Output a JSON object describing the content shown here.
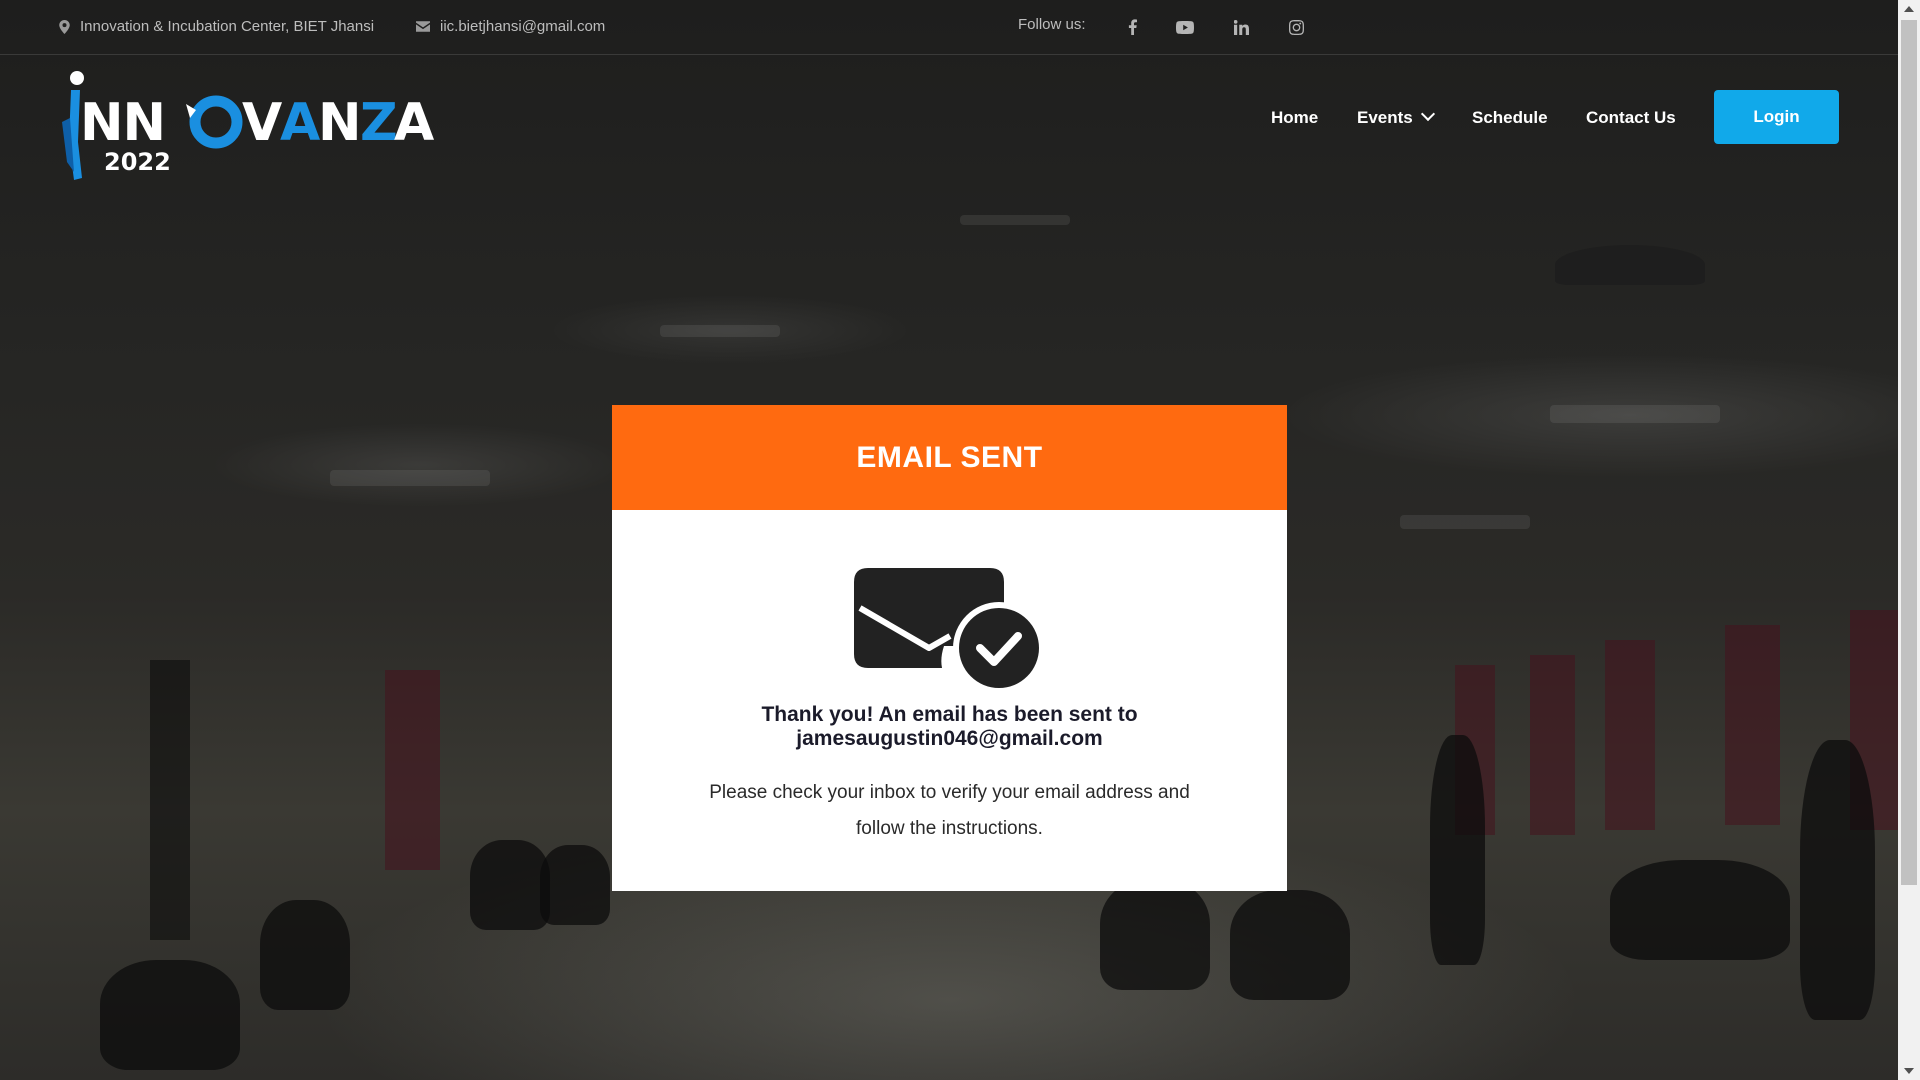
{
  "topbar": {
    "address": "Innovation & Incubation Center, BIET Jhansi",
    "email": "iic.bietjhansi@gmail.com",
    "follow_label": "Follow us:",
    "social_icons": [
      "facebook-icon",
      "youtube-icon",
      "linkedin-icon",
      "instagram-icon"
    ]
  },
  "logo": {
    "text": "INNOVANZA",
    "year": "2022"
  },
  "nav": {
    "home": "Home",
    "events": "Events",
    "schedule": "Schedule",
    "contact": "Contact Us",
    "login": "Login"
  },
  "card": {
    "header": "EMAIL SENT",
    "title_line1": "Thank you! An email has been sent to",
    "title_line2": "jamesaugustin046@gmail.com",
    "message_line1": "Please check your inbox to verify your email address and",
    "message_line2": "follow the instructions."
  },
  "colors": {
    "accent_orange": "#ff6a10",
    "login_blue": "#11a9ea",
    "logo_blue": "#1a8fe0"
  }
}
